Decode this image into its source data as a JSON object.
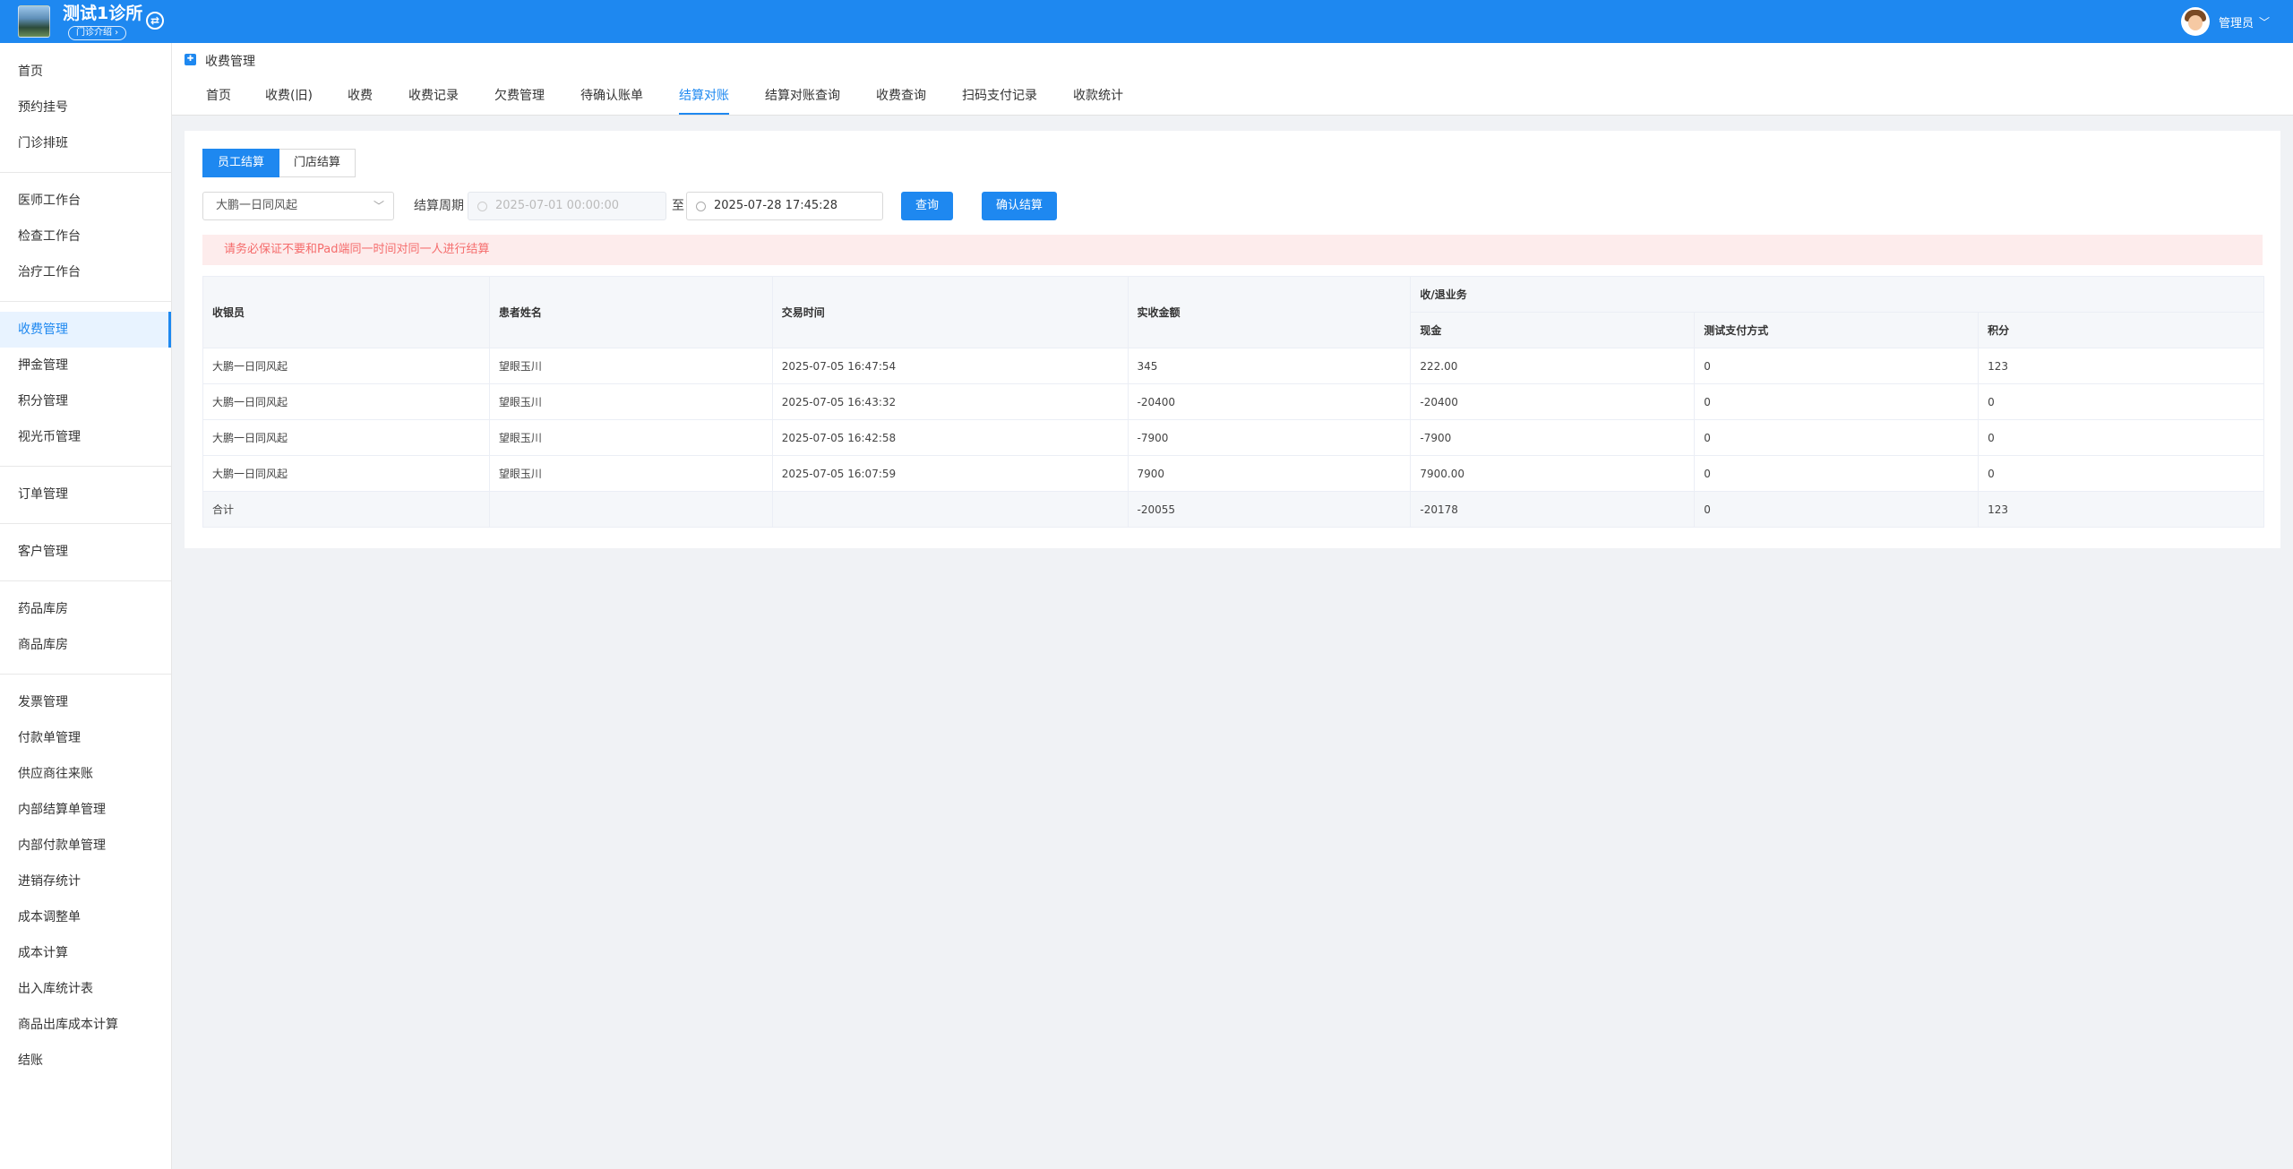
{
  "header": {
    "clinic_name": "测试1诊所",
    "clinic_badge": "门诊介绍 ›",
    "user_name": "管理员"
  },
  "sidebar": {
    "groups": [
      [
        "首页",
        "预约挂号",
        "门诊排班"
      ],
      [
        "医师工作台",
        "检查工作台",
        "治疗工作台"
      ],
      [
        "收费管理",
        "押金管理",
        "积分管理",
        "视光币管理"
      ],
      [
        "订单管理"
      ],
      [
        "客户管理"
      ],
      [
        "药品库房",
        "商品库房"
      ],
      [
        "发票管理",
        "付款单管理",
        "供应商往来账",
        "内部结算单管理",
        "内部付款单管理",
        "进销存统计",
        "成本调整单",
        "成本计算",
        "出入库统计表",
        "商品出库成本计算",
        "结账"
      ]
    ],
    "active": "收费管理"
  },
  "page": {
    "title": "收费管理",
    "icon": "clinic-icon"
  },
  "tabs": [
    {
      "label": "首页"
    },
    {
      "label": "收费(旧)"
    },
    {
      "label": "收费"
    },
    {
      "label": "收费记录"
    },
    {
      "label": "欠费管理"
    },
    {
      "label": "待确认账单"
    },
    {
      "label": "结算对账",
      "active": true
    },
    {
      "label": "结算对账查询"
    },
    {
      "label": "收费查询"
    },
    {
      "label": "扫码支付记录"
    },
    {
      "label": "收款统计"
    }
  ],
  "segment": {
    "options": [
      "员工结算",
      "门店结算"
    ],
    "selected": "员工结算"
  },
  "filters": {
    "cashier_select": "大鹏一日同风起",
    "period_label": "结算周期",
    "start_date": "2025-07-01 00:00:00",
    "to_label": "至",
    "end_date": "2025-07-28 17:45:28",
    "query_button": "查询",
    "confirm_button": "确认结算"
  },
  "alert": "请务必保证不要和Pad端同一时间对同一人进行结算",
  "table": {
    "headers": {
      "cashier": "收银员",
      "patient": "患者姓名",
      "time": "交易时间",
      "amount": "实收金额",
      "group": "收/退业务",
      "cash": "现金",
      "test_pay": "测试支付方式",
      "points": "积分"
    },
    "rows": [
      [
        "大鹏一日同风起",
        "望眼玉川",
        "2025-07-05 16:47:54",
        "345",
        "222.00",
        "0",
        "123"
      ],
      [
        "大鹏一日同风起",
        "望眼玉川",
        "2025-07-05 16:43:32",
        "-20400",
        "-20400",
        "0",
        "0"
      ],
      [
        "大鹏一日同风起",
        "望眼玉川",
        "2025-07-05 16:42:58",
        "-7900",
        "-7900",
        "0",
        "0"
      ],
      [
        "大鹏一日同风起",
        "望眼玉川",
        "2025-07-05 16:07:59",
        "7900",
        "7900.00",
        "0",
        "0"
      ]
    ],
    "summary": [
      "合计",
      "",
      "",
      "-20055",
      "-20178",
      "0",
      "123"
    ]
  },
  "colors": {
    "primary": "#1e88f0",
    "alert_bg": "#fdecec",
    "alert_text": "#f56c6c"
  }
}
